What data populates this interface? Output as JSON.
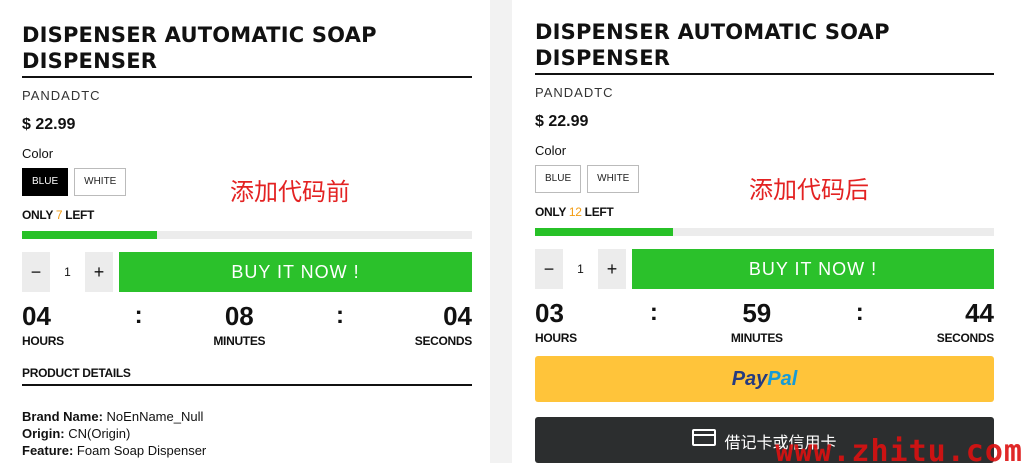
{
  "left": {
    "title": "DISPENSER AUTOMATIC SOAP DISPENSER",
    "vendor": "PANDADTC",
    "price": "$ 22.99",
    "color_label": "Color",
    "swatches": [
      "BLUE",
      "WHITE"
    ],
    "selected_swatch": "BLUE",
    "stock_prefix": "ONLY",
    "stock_count": "7",
    "stock_suffix": "LEFT",
    "stock_fraction": 0.3,
    "qty_minus": "−",
    "qty_value": "1",
    "qty_plus": "+",
    "buy_label": "BUY IT NOW !",
    "timer": {
      "hours": "04",
      "minutes": "08",
      "seconds": "04",
      "hours_label": "HOURS",
      "minutes_label": "MINUTES",
      "seconds_label": "SECONDS",
      "sep": ":"
    },
    "details_heading": "PRODUCT DETAILS",
    "specs": [
      {
        "key": "Brand Name:",
        "value": "NoEnName_Null"
      },
      {
        "key": "Origin:",
        "value": "CN(Origin)"
      },
      {
        "key": "Feature:",
        "value": "Foam Soap Dispenser"
      }
    ],
    "annotation": "添加代码前"
  },
  "right": {
    "title": "DISPENSER AUTOMATIC SOAP DISPENSER",
    "vendor": "PANDADTC",
    "price": "$ 22.99",
    "color_label": "Color",
    "swatches": [
      "BLUE",
      "WHITE"
    ],
    "stock_prefix": "ONLY",
    "stock_count": "12",
    "stock_suffix": "LEFT",
    "stock_fraction": 0.3,
    "qty_minus": "−",
    "qty_value": "1",
    "qty_plus": "+",
    "buy_label": "BUY IT NOW !",
    "timer": {
      "hours": "03",
      "minutes": "59",
      "seconds": "44",
      "hours_label": "HOURS",
      "minutes_label": "MINUTES",
      "seconds_label": "SECONDS",
      "sep": ":"
    },
    "paypal_pay": "Pay",
    "paypal_pal": "Pal",
    "card_label": "借记卡或信用卡",
    "annotation": "添加代码后"
  },
  "watermark": "www.zhitu.com",
  "colors": {
    "accent_green": "#2bc12b",
    "stock_orange": "#f39c12",
    "annotation_red": "#e32222",
    "paypal_yellow": "#ffc43a"
  }
}
